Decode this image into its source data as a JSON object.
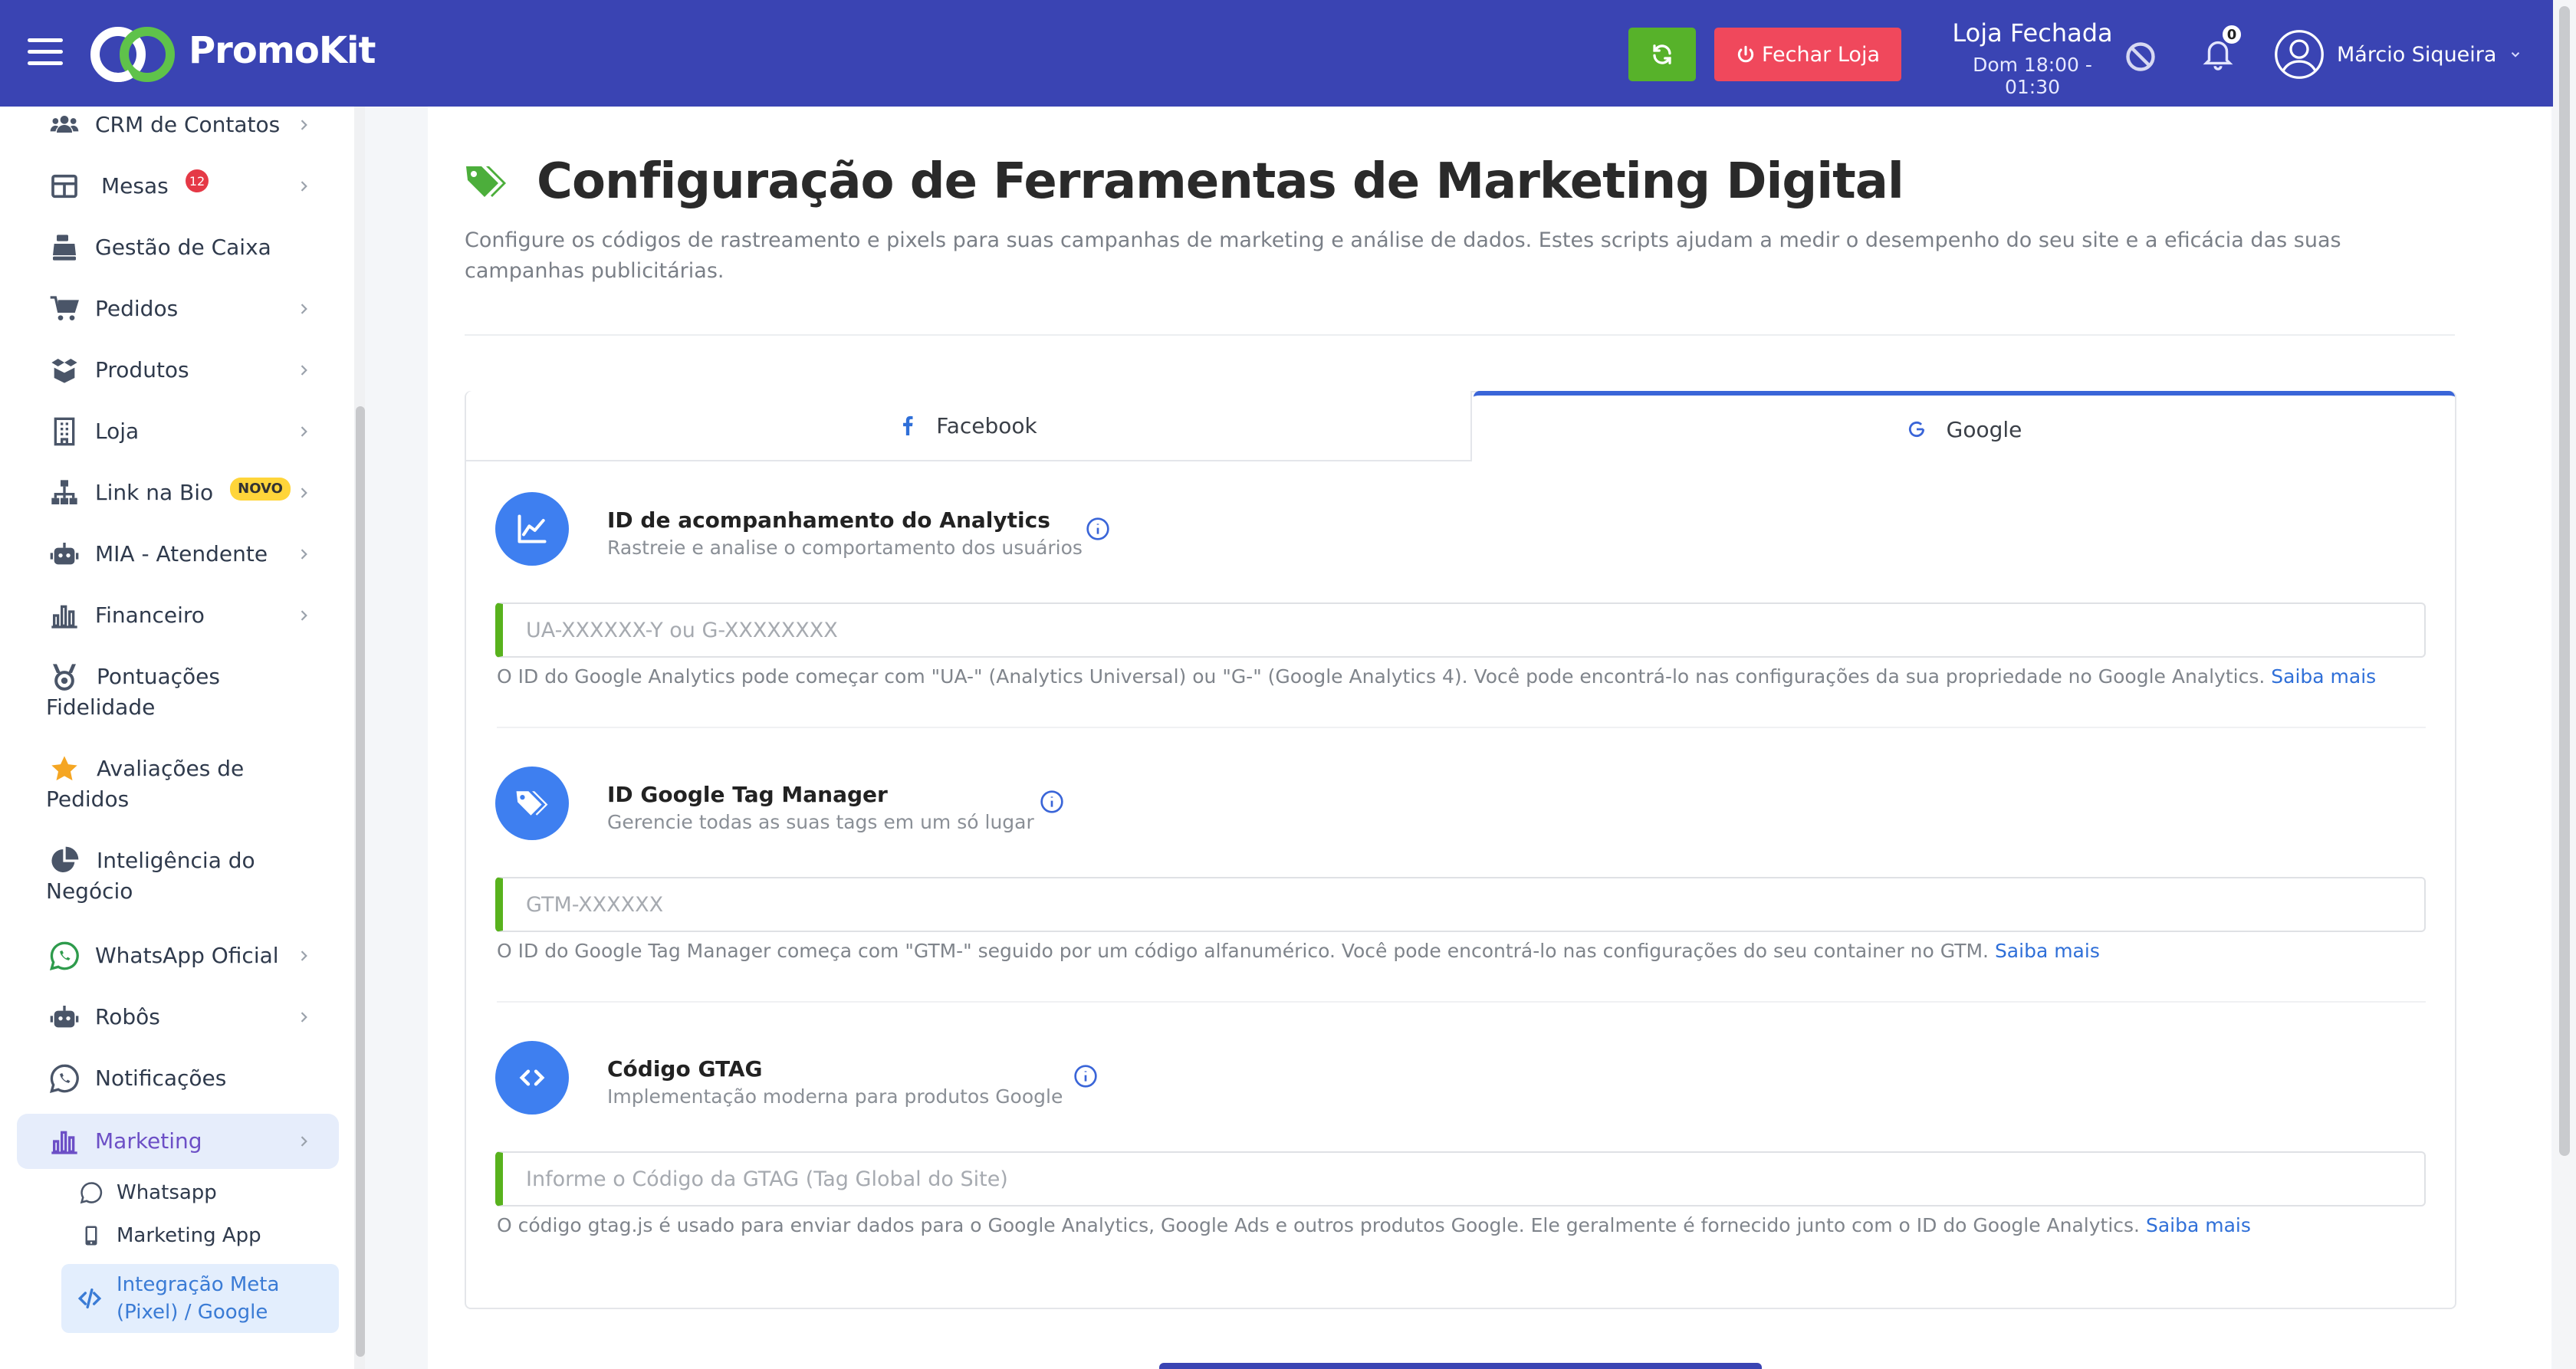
{
  "app": {
    "brand": "PromoKit",
    "close_store_label": "Fechar Loja",
    "store_status_title": "Loja Fechada",
    "store_status_hours": "Dom 18:00 - 01:30",
    "notifications_count": "0",
    "user_name": "Márcio Siqueira",
    "colors": {
      "topbar": "#3a44b3",
      "refresh": "#57b22a",
      "close": "#f0485c",
      "accent": "#3e7ff0"
    }
  },
  "sidebar": {
    "items": [
      {
        "label": "CRM de Contatos",
        "icon": "users-icon"
      },
      {
        "label": "Mesas",
        "badge": "12",
        "icon": "table-icon"
      },
      {
        "label": "Gestão de Caixa",
        "icon": "cash-register-icon"
      },
      {
        "label": "Pedidos",
        "icon": "cart-icon"
      },
      {
        "label": "Produtos",
        "icon": "box-icon"
      },
      {
        "label": "Loja",
        "icon": "building-icon"
      },
      {
        "label": "Link na Bio",
        "badge": "NOVO",
        "icon": "sitemap-icon"
      },
      {
        "label": "MIA - Atendente",
        "icon": "robot-icon"
      },
      {
        "label": "Financeiro",
        "icon": "bar-chart-icon"
      },
      {
        "label_line1": "Pontuações",
        "label_line2": "Fidelidade",
        "icon": "medal-icon"
      },
      {
        "label_line1": "Avaliações de",
        "label_line2": "Pedidos",
        "icon": "star-icon"
      },
      {
        "label_line1": "Inteligência do",
        "label_line2": "Negócio",
        "icon": "pie-chart-icon"
      },
      {
        "label": "WhatsApp Oficial",
        "icon": "whatsapp-icon"
      },
      {
        "label": "Robôs",
        "icon": "robot-icon"
      },
      {
        "label": "Notificações",
        "icon": "whatsapp-icon"
      },
      {
        "label": "Marketing",
        "icon": "bar-chart-icon"
      }
    ],
    "marketing_sub": [
      {
        "label": "Whatsapp"
      },
      {
        "label": "Marketing App"
      },
      {
        "label_line1": "Integração Meta",
        "label_line2": "(Pixel) / Google"
      }
    ]
  },
  "page": {
    "title": "Configuração de Ferramentas de Marketing Digital",
    "description": "Configure os códigos de rastreamento e pixels para suas campanhas de marketing e análise de dados. Estes scripts ajudam a medir o desempenho do seu site e a eficácia das suas campanhas publicitárias.",
    "tabs": [
      {
        "label": "Facebook",
        "active": false
      },
      {
        "label": "Google",
        "active": true
      }
    ],
    "sections": [
      {
        "title": "ID de acompanhamento do Analytics",
        "subtitle": "Rastreie e analise o comportamento dos usuários",
        "placeholder": "UA-XXXXXX-Y ou G-XXXXXXXX",
        "value": "",
        "help": "O ID do Google Analytics pode começar com \"UA-\" (Analytics Universal) ou \"G-\" (Google Analytics 4). Você pode encontrá-lo nas configurações da sua propriedade no Google Analytics.",
        "link": "Saiba mais"
      },
      {
        "title": "ID Google Tag Manager",
        "subtitle": "Gerencie todas as suas tags em um só lugar",
        "placeholder": "GTM-XXXXXX",
        "value": "",
        "help": "O ID do Google Tag Manager começa com \"GTM-\" seguido por um código alfanumérico. Você pode encontrá-lo nas configurações do seu container no GTM.",
        "link": "Saiba mais"
      },
      {
        "title": "Código GTAG",
        "subtitle": "Implementação moderna para produtos Google",
        "placeholder": "Informe o Código da GTAG (Tag Global do Site)",
        "value": "",
        "help": "O código gtag.js é usado para enviar dados para o Google Analytics, Google Ads e outros produtos Google. Ele geralmente é fornecido junto com o ID do Google Analytics.",
        "link": "Saiba mais"
      }
    ]
  }
}
